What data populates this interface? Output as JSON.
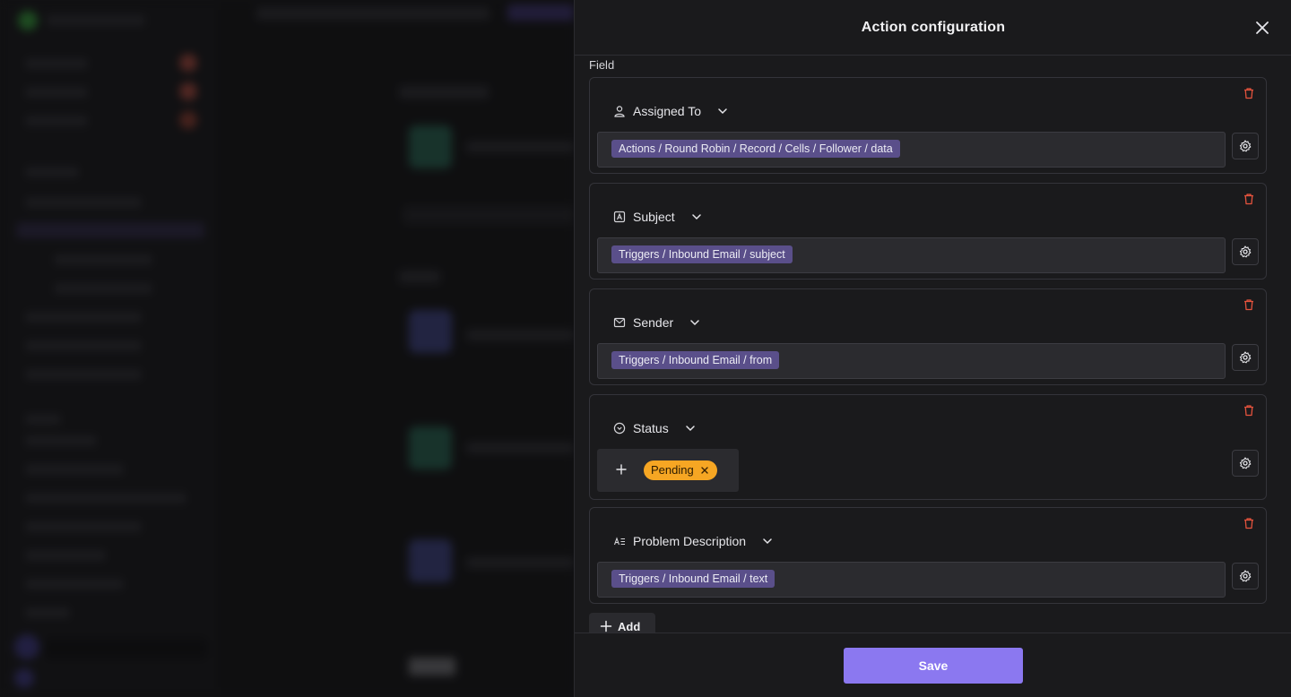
{
  "drawer": {
    "title": "Action configuration",
    "field_section_label": "Field",
    "add_label": "Add",
    "save_label": "Save"
  },
  "fields": [
    {
      "name": "Assigned To",
      "icon": "user-icon",
      "value": "Actions / Round Robin / Record / Cells / Follower / data"
    },
    {
      "name": "Subject",
      "icon": "text-icon",
      "value": "Triggers / Inbound Email / subject"
    },
    {
      "name": "Sender",
      "icon": "mail-icon",
      "value": "Triggers / Inbound Email / from"
    },
    {
      "name": "Status",
      "icon": "status-icon",
      "value": "Pending"
    },
    {
      "name": "Problem Description",
      "icon": "long-text-icon",
      "value": "Triggers / Inbound Email / text"
    }
  ],
  "colors": {
    "accent": "#8b78f0",
    "chip_bg": "#5a4f8a",
    "status_pending": "#f6a623",
    "danger": "#e5533d"
  }
}
